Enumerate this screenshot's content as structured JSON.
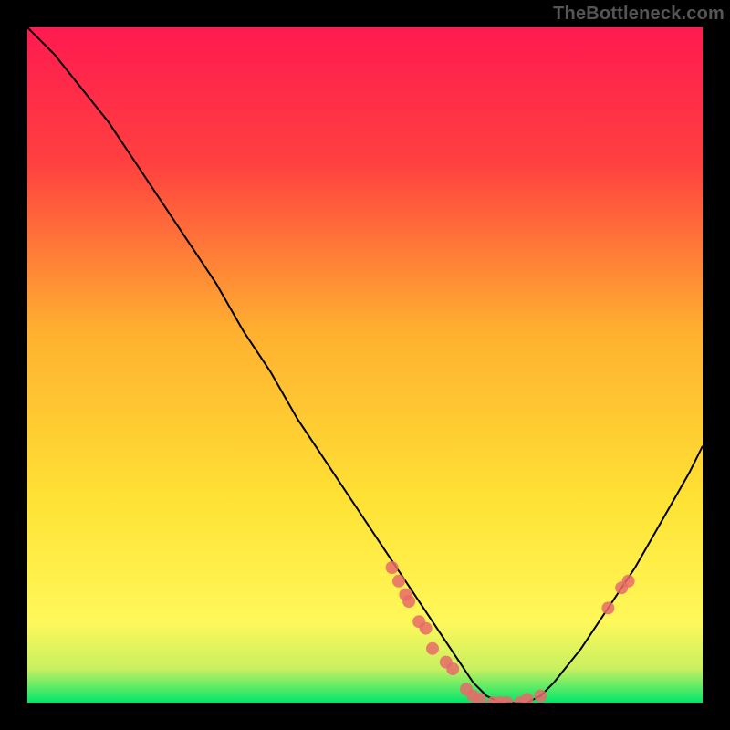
{
  "watermark": "TheBottleneck.com",
  "chart_data": {
    "type": "line",
    "title": "",
    "xlabel": "",
    "ylabel": "",
    "xlim": [
      0,
      100
    ],
    "ylim": [
      0,
      100
    ],
    "legend": false,
    "grid": false,
    "background_gradient": {
      "top": "#ff1a50",
      "mid": "#ffe234",
      "bottom": "#00e66a"
    },
    "series": [
      {
        "name": "bottleneck-curve",
        "color": "#000000",
        "x": [
          0,
          4,
          8,
          12,
          16,
          20,
          24,
          28,
          32,
          36,
          40,
          44,
          48,
          52,
          56,
          60,
          62,
          64,
          66,
          68,
          70,
          72,
          74,
          76,
          78,
          82,
          86,
          90,
          94,
          98,
          100
        ],
        "y": [
          100,
          96,
          91,
          86,
          80,
          74,
          68,
          62,
          55,
          49,
          42,
          36,
          30,
          24,
          18,
          12,
          9,
          6,
          3,
          1,
          0,
          0,
          0,
          1,
          3,
          8,
          14,
          20,
          27,
          34,
          38
        ]
      }
    ],
    "markers": {
      "name": "benchmark-points",
      "color": "#e86a6a",
      "size": 7,
      "points": [
        {
          "x": 54,
          "y": 20
        },
        {
          "x": 55,
          "y": 18
        },
        {
          "x": 56,
          "y": 16
        },
        {
          "x": 56.5,
          "y": 15
        },
        {
          "x": 58,
          "y": 12
        },
        {
          "x": 59,
          "y": 11
        },
        {
          "x": 60,
          "y": 8
        },
        {
          "x": 62,
          "y": 6
        },
        {
          "x": 63,
          "y": 5
        },
        {
          "x": 65,
          "y": 2
        },
        {
          "x": 66,
          "y": 1
        },
        {
          "x": 67,
          "y": 0.5
        },
        {
          "x": 69,
          "y": 0
        },
        {
          "x": 70,
          "y": 0
        },
        {
          "x": 71,
          "y": 0
        },
        {
          "x": 73,
          "y": 0
        },
        {
          "x": 74,
          "y": 0.5
        },
        {
          "x": 76,
          "y": 1
        },
        {
          "x": 86,
          "y": 14
        },
        {
          "x": 88,
          "y": 17
        },
        {
          "x": 89,
          "y": 18
        }
      ]
    }
  }
}
